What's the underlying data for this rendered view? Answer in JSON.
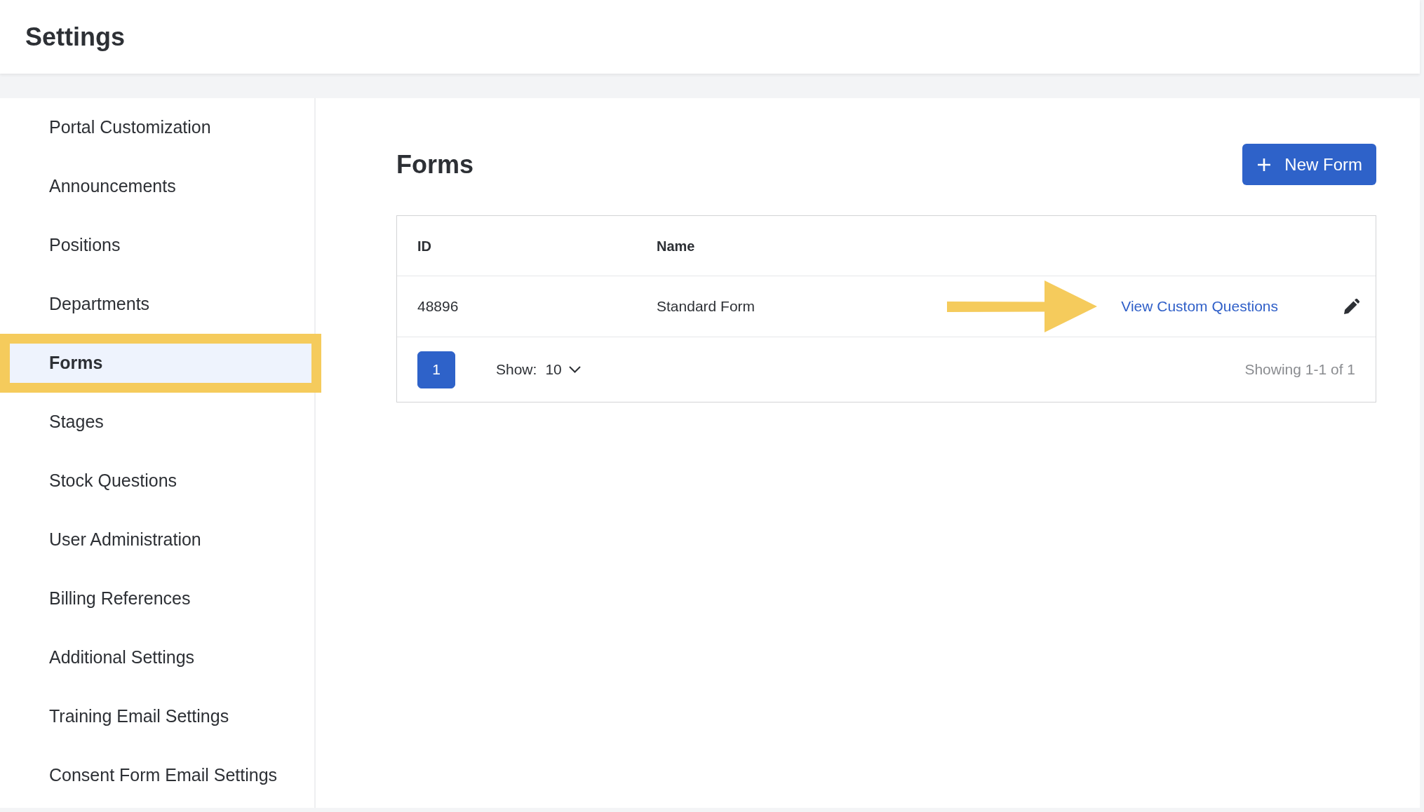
{
  "header": {
    "title": "Settings"
  },
  "sidebar": {
    "items": [
      {
        "label": "Portal Customization",
        "selected": false,
        "highlighted": false
      },
      {
        "label": "Announcements",
        "selected": false,
        "highlighted": false
      },
      {
        "label": "Positions",
        "selected": false,
        "highlighted": false
      },
      {
        "label": "Departments",
        "selected": false,
        "highlighted": false
      },
      {
        "label": "Forms",
        "selected": true,
        "highlighted": true
      },
      {
        "label": "Stages",
        "selected": false,
        "highlighted": false
      },
      {
        "label": "Stock Questions",
        "selected": false,
        "highlighted": false
      },
      {
        "label": "User Administration",
        "selected": false,
        "highlighted": false
      },
      {
        "label": "Billing References",
        "selected": false,
        "highlighted": false
      },
      {
        "label": "Additional Settings",
        "selected": false,
        "highlighted": false
      },
      {
        "label": "Training Email Settings",
        "selected": false,
        "highlighted": false
      },
      {
        "label": "Consent Form Email Settings",
        "selected": false,
        "highlighted": false
      }
    ]
  },
  "main": {
    "title": "Forms",
    "new_button": {
      "label": "New Form"
    },
    "table": {
      "columns": [
        "ID",
        "Name"
      ],
      "rows": [
        {
          "id": "48896",
          "name": "Standard Form",
          "link": "View Custom Questions",
          "arrow": true
        }
      ],
      "pagination": {
        "pages": [
          {
            "label": "1",
            "selected": true
          }
        ],
        "show_label": "Show:",
        "page_size": "10",
        "summary": "Showing 1-1 of 1"
      }
    }
  }
}
